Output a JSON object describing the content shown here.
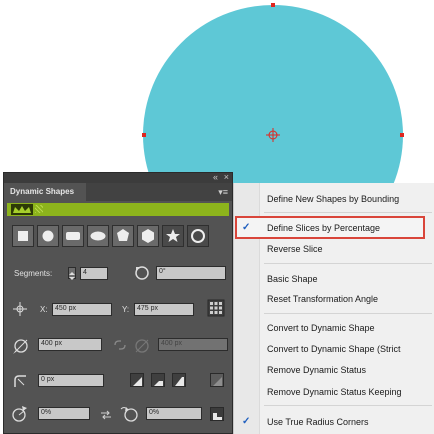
{
  "panel": {
    "title": "Dynamic Shapes",
    "collapse_glyph": "«",
    "close_glyph": "×",
    "menu_glyph": "▾≡",
    "segments_label": "Segments:",
    "segments_value": "4",
    "rotation_value": "0°",
    "x_label": "X:",
    "x_value": "450 px",
    "y_label": "Y:",
    "y_value": "475 px",
    "width_value": "400 px",
    "height_value": "400 px",
    "corner_value": "0 px",
    "start_pct": "0%",
    "end_pct": "0%",
    "accent_color": "#8db41c"
  },
  "menu": {
    "items": [
      {
        "label": "Define New Shapes by Bounding",
        "checked": false
      },
      {
        "label": "Define Slices by Percentage",
        "checked": true
      },
      {
        "label": "Reverse Slice",
        "checked": false
      },
      {
        "label": "Basic Shape",
        "checked": false
      },
      {
        "label": "Reset Transformation Angle",
        "checked": false
      },
      {
        "label": "Convert to Dynamic Shape",
        "checked": false
      },
      {
        "label": "Convert to Dynamic Shape (Strict",
        "checked": false
      },
      {
        "label": "Remove Dynamic Status",
        "checked": false
      },
      {
        "label": "Remove Dynamic Status Keeping",
        "checked": false
      },
      {
        "label": "Use True Radius Corners",
        "checked": true
      }
    ],
    "check_glyph": "✓",
    "highlight_color": "#d9453a"
  },
  "canvas": {
    "shape_fill": "#5ec8d6",
    "handle_color": "#e0261f"
  }
}
